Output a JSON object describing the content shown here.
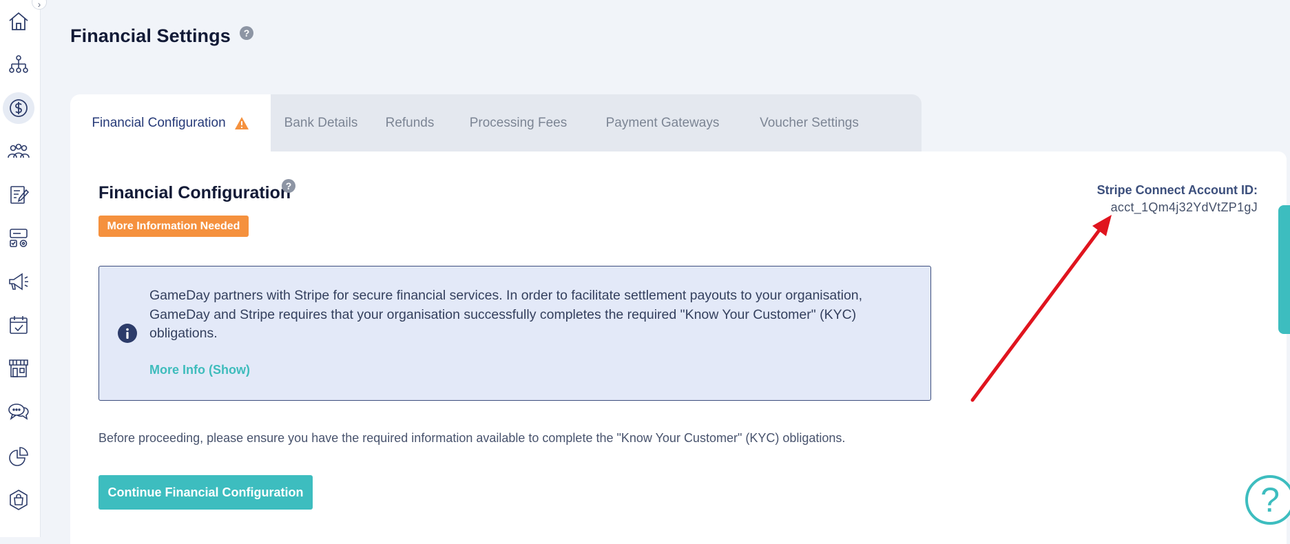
{
  "page": {
    "title": "Financial Settings",
    "help_glyph": "?"
  },
  "sidebar": {
    "toggle_glyph": "›",
    "items": [
      {
        "icon": "home-icon"
      },
      {
        "icon": "org-chart-icon"
      },
      {
        "icon": "dollar-icon",
        "active": true
      },
      {
        "icon": "members-icon"
      },
      {
        "icon": "registration-form-icon"
      },
      {
        "icon": "controls-icon"
      },
      {
        "icon": "megaphone-icon"
      },
      {
        "icon": "calendar-check-icon"
      },
      {
        "icon": "shop-icon"
      },
      {
        "icon": "chat-icon"
      },
      {
        "icon": "pie-chart-icon"
      },
      {
        "icon": "shopping-bag-icon"
      }
    ]
  },
  "tabs": [
    {
      "label": "Financial Configuration",
      "active": true,
      "warning": true
    },
    {
      "label": "Bank Details"
    },
    {
      "label": "Refunds"
    },
    {
      "label": "Processing Fees"
    },
    {
      "label": "Payment Gateways"
    },
    {
      "label": "Voucher Settings"
    }
  ],
  "section": {
    "title": "Financial Configuration",
    "help_glyph": "?",
    "status_badge": "More Information Needed"
  },
  "stripe": {
    "label": "Stripe Connect Account ID:",
    "account_id": "acct_1Qm4j32YdVtZP1gJ"
  },
  "info_box": {
    "text": "GameDay partners with Stripe for secure financial services. In order to facilitate settlement payouts to your organisation, GameDay and Stripe requires that your organisation successfully completes the required \"Know Your Customer\" (KYC) obligations.",
    "link": "More Info (Show)"
  },
  "note": "Before proceeding, please ensure you have the required information available to complete the \"Know Your Customer\" (KYC) obligations.",
  "cta": {
    "label": "Continue Financial Configuration"
  },
  "help_fab": {
    "glyph": "?"
  },
  "colors": {
    "accent": "#3dbdbf",
    "warning": "#f5913e",
    "annotation_arrow": "#e0141e",
    "active_tab_text": "#263a78"
  }
}
